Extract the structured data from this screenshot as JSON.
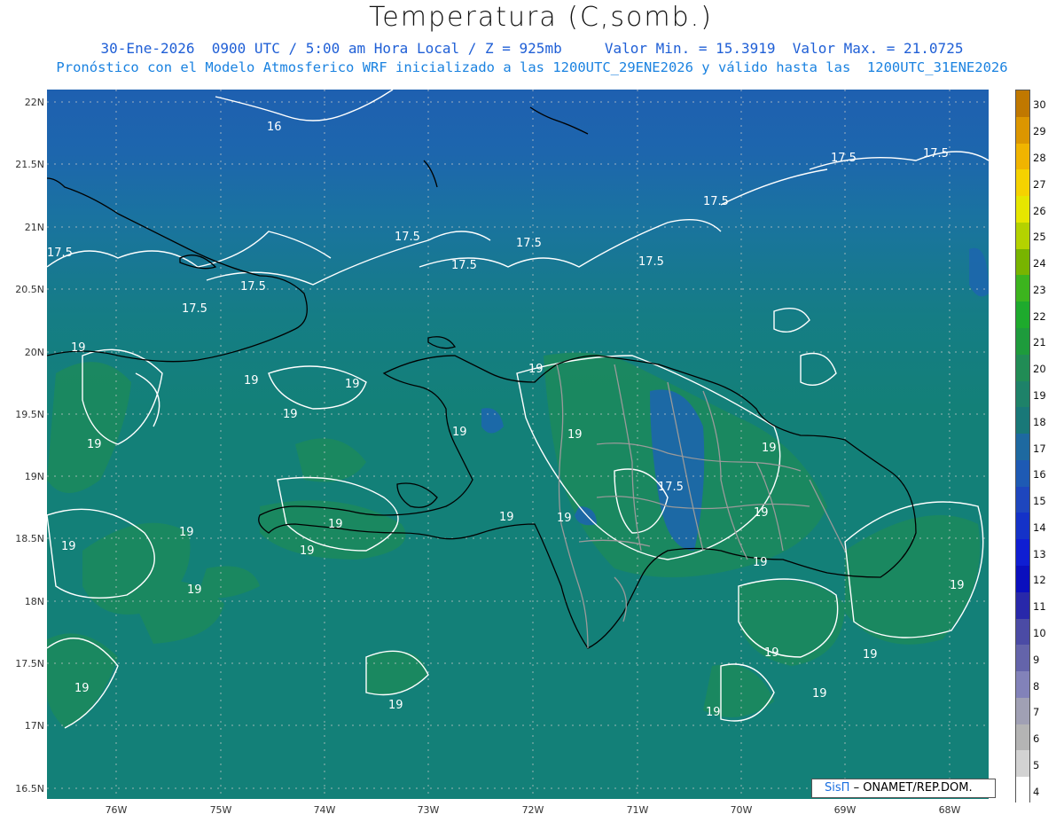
{
  "header": {
    "title": "Temperatura (C,somb.)",
    "line1": "30-Ene-2026  0900 UTC / 5:00 am Hora Local / Z = 925mb",
    "valor_min": "Valor Min. = 15.3919",
    "valor_max": "Valor Max. = 21.0725",
    "line2": "Pronóstico con el Modelo Atmosferico WRF inicializado a las 1200UTC_29ENE2026 y válido hasta las  1200UTC_31ENE2026"
  },
  "axes": {
    "lat_labels": [
      "22N",
      "21.5N",
      "21N",
      "20.5N",
      "20N",
      "19.5N",
      "19N",
      "18.5N",
      "18N",
      "17.5N",
      "17N",
      "16.5N"
    ],
    "lon_labels": [
      "76W",
      "75W",
      "74W",
      "73W",
      "72W",
      "71W",
      "70W",
      "69W",
      "68W"
    ]
  },
  "colorbar": {
    "labels": [
      "30",
      "29",
      "28",
      "27",
      "26",
      "25",
      "24",
      "23",
      "22",
      "21",
      "20",
      "19",
      "18",
      "17",
      "16",
      "15",
      "14",
      "13",
      "12",
      "11",
      "10",
      "9",
      "8",
      "7",
      "6",
      "5",
      "4"
    ],
    "colors": [
      "#c07800",
      "#dc9600",
      "#f0b400",
      "#f5d200",
      "#e6e600",
      "#b4d200",
      "#78b400",
      "#3cb41e",
      "#1eaa2d",
      "#1e9b3c",
      "#218c55",
      "#1e8269",
      "#197878",
      "#1e69a0",
      "#1e5ab4",
      "#1e46be",
      "#1432c8",
      "#0f1ed2",
      "#0a0fbe",
      "#2828aa",
      "#4b4ba5",
      "#6464aa",
      "#8282b9",
      "#a0a0b4",
      "#b4b4b4",
      "#d2d2d2",
      "#ffffff"
    ]
  },
  "contour_labels": [
    "16",
    "17.5",
    "17.5",
    "17.5",
    "17.5",
    "17.5",
    "17.5",
    "17.5",
    "17.5",
    "17.5",
    "17.5",
    "19",
    "19",
    "19",
    "19",
    "19",
    "19",
    "19",
    "19",
    "19",
    "19",
    "19",
    "19",
    "19",
    "19",
    "19",
    "19",
    "19",
    "19",
    "19",
    "19",
    "19",
    "19",
    "19",
    "19",
    "19",
    "19",
    "17.5"
  ],
  "credit": {
    "brand": "SisΠ",
    "text": "– ONAMET/REP.DOM."
  }
}
